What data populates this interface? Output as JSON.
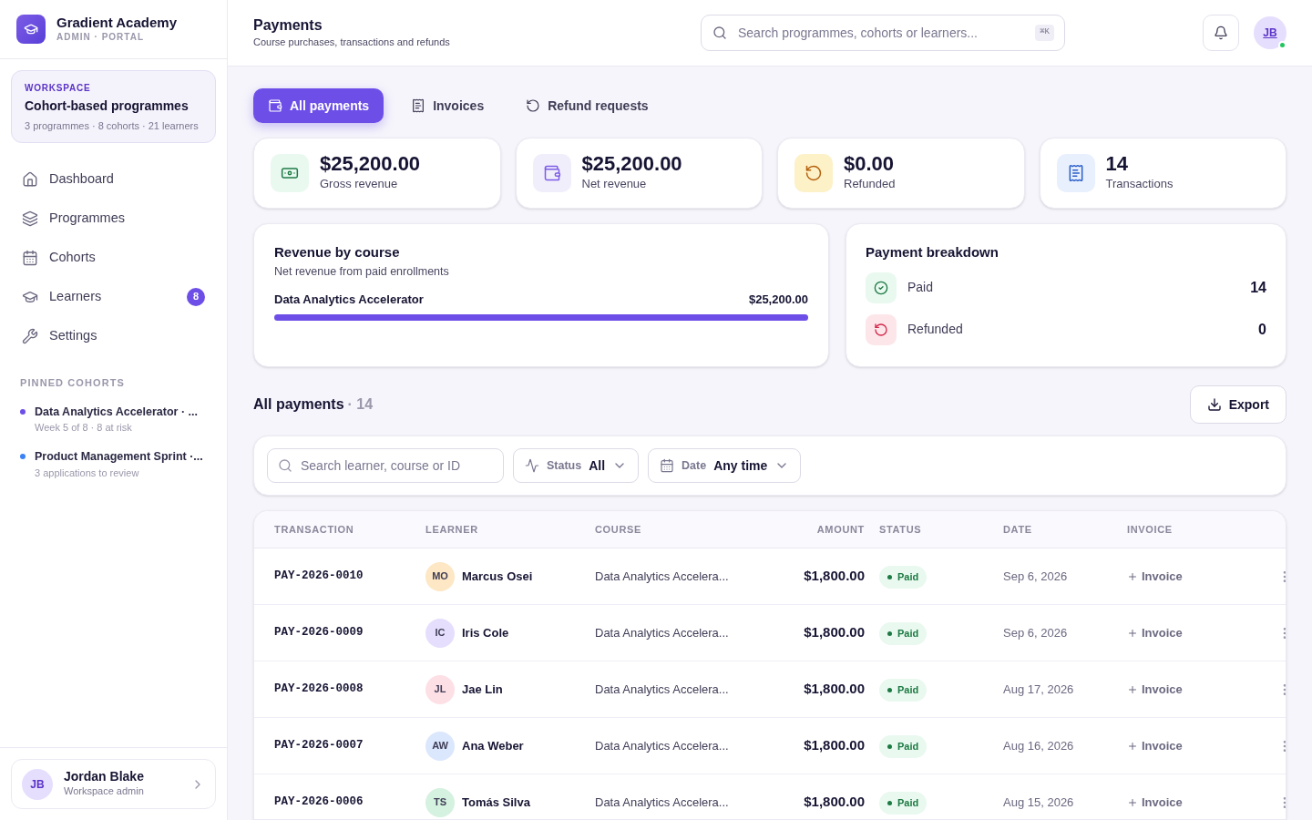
{
  "brand": {
    "name": "Gradient Academy",
    "subtitle": "ADMIN · PORTAL"
  },
  "workspace": {
    "label": "WORKSPACE",
    "title": "Cohort-based programmes",
    "meta": "3 programmes · 8 cohorts · 21 learners"
  },
  "nav": [
    {
      "label": "Dashboard"
    },
    {
      "label": "Programmes"
    },
    {
      "label": "Cohorts"
    },
    {
      "label": "Learners",
      "badge": "8"
    },
    {
      "label": "Settings"
    }
  ],
  "pinned": {
    "heading": "PINNED COHORTS",
    "items": [
      {
        "title": "Data Analytics Accelerator · ...",
        "meta": "Week 5 of 8 · 8 at risk",
        "color": "#6d4fe8"
      },
      {
        "title": "Product Management Sprint ·...",
        "meta": "3 applications to review",
        "color": "#3b82f6"
      }
    ]
  },
  "user": {
    "initials": "JB",
    "name": "Jordan Blake",
    "role": "Workspace admin"
  },
  "header": {
    "title": "Payments",
    "subtitle": "Course purchases, transactions and refunds",
    "search_placeholder": "Search programmes, cohorts or learners...",
    "shortcut": "⌘K",
    "avatar": "JB"
  },
  "tabs": [
    {
      "label": "All payments",
      "selected": true
    },
    {
      "label": "Invoices",
      "selected": false
    },
    {
      "label": "Refund requests",
      "selected": false
    }
  ],
  "stats": [
    {
      "value": "$25,200.00",
      "label": "Gross revenue"
    },
    {
      "value": "$25,200.00",
      "label": "Net revenue"
    },
    {
      "value": "$0.00",
      "label": "Refunded"
    },
    {
      "value": "14",
      "label": "Transactions"
    }
  ],
  "revenue": {
    "title": "Revenue by course",
    "subtitle": "Net revenue from paid enrollments",
    "courses": [
      {
        "name": "Data Analytics Accelerator",
        "amount": "$25,200.00",
        "level": 1
      }
    ]
  },
  "breakdown": {
    "title": "Payment breakdown",
    "items": [
      {
        "label": "Paid",
        "count": "14",
        "kind": "paid"
      },
      {
        "label": "Refunded",
        "count": "0",
        "kind": "refunded"
      }
    ]
  },
  "payments": {
    "title": "All payments",
    "count": "· 14",
    "export": "Export",
    "search_placeholder": "Search learner, course or ID",
    "filters": [
      {
        "label": "Status",
        "value": "All"
      },
      {
        "label": "Date",
        "value": "Any time"
      }
    ],
    "columns": [
      "TRANSACTION",
      "LEARNER",
      "COURSE",
      "AMOUNT",
      "STATUS",
      "DATE",
      "INVOICE"
    ],
    "rows": [
      {
        "id": "PAY-2026-0010",
        "initials": "MO",
        "learner": "Marcus Osei",
        "color": "#fde7c4",
        "course": "Data Analytics Accelera...",
        "amount": "$1,800.00",
        "status": "Paid",
        "kind": "paid",
        "date": "Sep 6, 2026",
        "invoice": "Invoice"
      },
      {
        "id": "PAY-2026-0009",
        "initials": "IC",
        "learner": "Iris Cole",
        "color": "#e6defd",
        "course": "Data Analytics Accelera...",
        "amount": "$1,800.00",
        "status": "Paid",
        "kind": "paid",
        "date": "Sep 6, 2026",
        "invoice": "Invoice"
      },
      {
        "id": "PAY-2026-0008",
        "initials": "JL",
        "learner": "Jae Lin",
        "color": "#fde0e6",
        "course": "Data Analytics Accelera...",
        "amount": "$1,800.00",
        "status": "Paid",
        "kind": "paid",
        "date": "Aug 17, 2026",
        "invoice": "Invoice"
      },
      {
        "id": "PAY-2026-0007",
        "initials": "AW",
        "learner": "Ana Weber",
        "color": "#dbe7fd",
        "course": "Data Analytics Accelera...",
        "amount": "$1,800.00",
        "status": "Paid",
        "kind": "paid",
        "date": "Aug 16, 2026",
        "invoice": "Invoice"
      },
      {
        "id": "PAY-2026-0006",
        "initials": "TS",
        "learner": "Tomás Silva",
        "color": "#d5f1df",
        "course": "Data Analytics Accelera...",
        "amount": "$1,800.00",
        "status": "Paid",
        "kind": "paid",
        "date": "Aug 15, 2026",
        "invoice": "Invoice"
      }
    ]
  }
}
